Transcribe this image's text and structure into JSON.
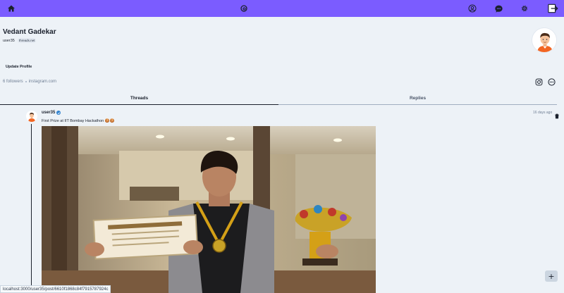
{
  "nav": {
    "home_icon": "home-icon",
    "logo_icon": "threads-logo-icon",
    "profile_icon": "user-circle-icon",
    "chat_icon": "chat-icon",
    "settings_icon": "gear-icon",
    "logout_icon": "logout-icon"
  },
  "profile": {
    "name": "Vedant Gadekar",
    "username": "user35",
    "domain_badge": "threads.net",
    "update_button": "Update Profile",
    "followers": "6 followers",
    "link": "instagram.com"
  },
  "tabs": [
    {
      "label": "Threads",
      "active": true
    },
    {
      "label": "Replies",
      "active": false
    }
  ],
  "post": {
    "username": "user35",
    "time": "16 days ago",
    "text": "First Prize at IIT Bombay Hackathon 🍪🍪"
  },
  "status_url": "localhost:3000/user35/post/6610f1868c84f7915787924c",
  "fab_label": "+",
  "colors": {
    "accent": "#7b5cff",
    "background": "#edf2f7",
    "verified": "#3182ce"
  }
}
